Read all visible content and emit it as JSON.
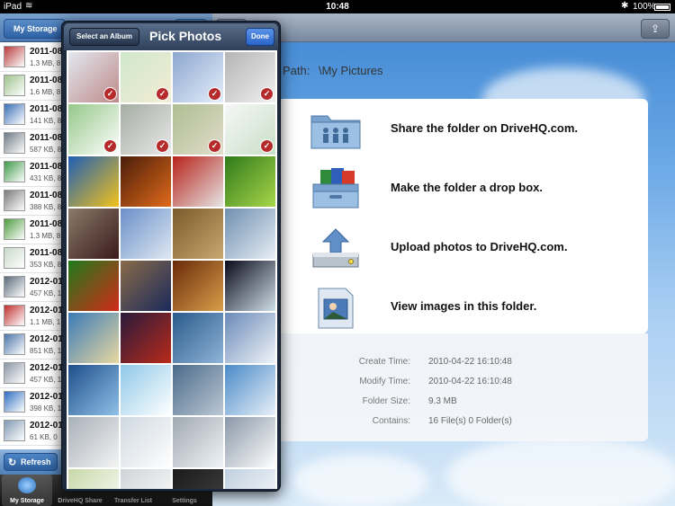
{
  "status_bar": {
    "carrier": "iPad",
    "time": "10:48",
    "battery": "100%"
  },
  "left_panel": {
    "back_label": "My Storage",
    "files": [
      {
        "name": "2011-08",
        "size": "1.3 MB, 8",
        "color": "#b83a3a"
      },
      {
        "name": "2011-08",
        "size": "1.6 MB, 8",
        "color": "#9ec28e"
      },
      {
        "name": "2011-08",
        "size": "141 KB, 8",
        "color": "#3a6fb8"
      },
      {
        "name": "2011-08",
        "size": "587 KB, 8",
        "color": "#6f7a86"
      },
      {
        "name": "2011-08",
        "size": "431 KB, 8",
        "color": "#3f9a4a"
      },
      {
        "name": "2011-08",
        "size": "388 KB, 8",
        "color": "#7a7a7a"
      },
      {
        "name": "2011-08",
        "size": "1.3 MB, 8",
        "color": "#4e9a3e"
      },
      {
        "name": "2011-08",
        "size": "353 KB, 8",
        "color": "#c8d8c8"
      },
      {
        "name": "2012-01",
        "size": "457 KB, 1",
        "color": "#5a6a7a"
      },
      {
        "name": "2012-01",
        "size": "1.1 MB, 1",
        "color": "#c03030"
      },
      {
        "name": "2012-01",
        "size": "851 KB, 1",
        "color": "#4a74a8"
      },
      {
        "name": "2012-01",
        "size": "457 KB, 1",
        "color": "#8a96a4"
      },
      {
        "name": "2012-01",
        "size": "398 KB, 1",
        "color": "#2f6fc0"
      },
      {
        "name": "2012-01",
        "size": "61 KB, 0",
        "color": "#7f98b4"
      }
    ],
    "refresh_label": "Refresh",
    "tabs": [
      "My Storage",
      "DriveHQ Share",
      "Transfer List",
      "Settings"
    ]
  },
  "picker": {
    "album_button": "Select an Album",
    "title": "Pick Photos",
    "done_button": "Done",
    "photos": [
      {
        "colors": [
          "#c9d6e2",
          "#8a2a2a"
        ],
        "selected": true
      },
      {
        "colors": [
          "#a8d4a2",
          "#e9ddb0"
        ],
        "selected": true
      },
      {
        "colors": [
          "#2f5fa8",
          "#cfe0f5"
        ],
        "selected": true
      },
      {
        "colors": [
          "#777777",
          "#e5e5e5"
        ],
        "selected": true
      },
      {
        "colors": [
          "#3e9a2a",
          "#ffffff"
        ],
        "selected": true
      },
      {
        "colors": [
          "#5b6a58",
          "#d6d6d6"
        ],
        "selected": true
      },
      {
        "colors": [
          "#6c8a3a",
          "#c9c0a0"
        ],
        "selected": true
      },
      {
        "colors": [
          "#eef1ee",
          "#9bc49b"
        ],
        "selected": true
      },
      {
        "colors": [
          "#1f5fb5",
          "#f2c21a"
        ],
        "selected": false
      },
      {
        "colors": [
          "#4a1d0a",
          "#e06a1a"
        ],
        "selected": false
      },
      {
        "colors": [
          "#b8221a",
          "#e5e5e5"
        ],
        "selected": false
      },
      {
        "colors": [
          "#2f7a1a",
          "#a8d64a"
        ],
        "selected": false
      },
      {
        "colors": [
          "#8a7a6a",
          "#3a1a1a"
        ],
        "selected": false
      },
      {
        "colors": [
          "#6a8fc8",
          "#dfe8f2"
        ],
        "selected": false
      },
      {
        "colors": [
          "#7a5a2a",
          "#c9a870"
        ],
        "selected": false
      },
      {
        "colors": [
          "#6f8faf",
          "#e7eef6"
        ],
        "selected": false
      },
      {
        "colors": [
          "#1f7a1a",
          "#d22a1a"
        ],
        "selected": false
      },
      {
        "colors": [
          "#8a6a4a",
          "#1a2a5a"
        ],
        "selected": false
      },
      {
        "colors": [
          "#6a2a0a",
          "#d8a04a"
        ],
        "selected": false
      },
      {
        "colors": [
          "#0a0a1a",
          "#cfdfe8"
        ],
        "selected": false
      },
      {
        "colors": [
          "#3a7ab8",
          "#e8d8a0"
        ],
        "selected": false
      },
      {
        "colors": [
          "#2a1a3a",
          "#b82a1a"
        ],
        "selected": false
      },
      {
        "colors": [
          "#2a5a8a",
          "#8fb4d8"
        ],
        "selected": false
      },
      {
        "colors": [
          "#6a8ab8",
          "#f0f4f8"
        ],
        "selected": false
      },
      {
        "colors": [
          "#1f4f8a",
          "#8fc0e8"
        ],
        "selected": false
      },
      {
        "colors": [
          "#8fc8e8",
          "#ffffff"
        ],
        "selected": false
      },
      {
        "colors": [
          "#4a6a8a",
          "#bcc8d4"
        ],
        "selected": false
      },
      {
        "colors": [
          "#4a8ac8",
          "#e8f0f8"
        ],
        "selected": false
      },
      {
        "colors": [
          "#a8b0b8",
          "#f4f4f4"
        ],
        "selected": false
      },
      {
        "colors": [
          "#cfd8e0",
          "#ffffff"
        ],
        "selected": false
      },
      {
        "colors": [
          "#a0a8b0",
          "#f0f4f8"
        ],
        "selected": false
      },
      {
        "colors": [
          "#8a98a8",
          "#ffffff"
        ],
        "selected": false
      },
      {
        "colors": [
          "#c8d8a8",
          "#ffffff"
        ],
        "selected": false
      },
      {
        "colors": [
          "#cfd4d8",
          "#ffffff"
        ],
        "selected": false
      },
      {
        "colors": [
          "#1a1a1a",
          "#444444"
        ],
        "selected": false
      },
      {
        "colors": [
          "#bfcfdf",
          "#ffffff"
        ],
        "selected": false
      }
    ]
  },
  "detail": {
    "path_label": "Path:",
    "path_value": "\\My Pictures",
    "actions": [
      {
        "label": "Share the folder on DriveHQ.com.",
        "icon": "shared-folder-icon"
      },
      {
        "label": "Make the folder a drop box.",
        "icon": "drop-box-icon"
      },
      {
        "label": "Upload photos to DriveHQ.com.",
        "icon": "upload-icon"
      },
      {
        "label": "View images in this folder.",
        "icon": "image-viewer-icon"
      }
    ],
    "info": [
      {
        "key": "Create Time:",
        "value": "2010-04-22 16:10:48"
      },
      {
        "key": "Modify Time:",
        "value": "2010-04-22 16:10:48"
      },
      {
        "key": "Folder Size:",
        "value": "9.3 MB"
      },
      {
        "key": "Contains:",
        "value": "16 File(s) 0 Folder(s)"
      }
    ]
  }
}
